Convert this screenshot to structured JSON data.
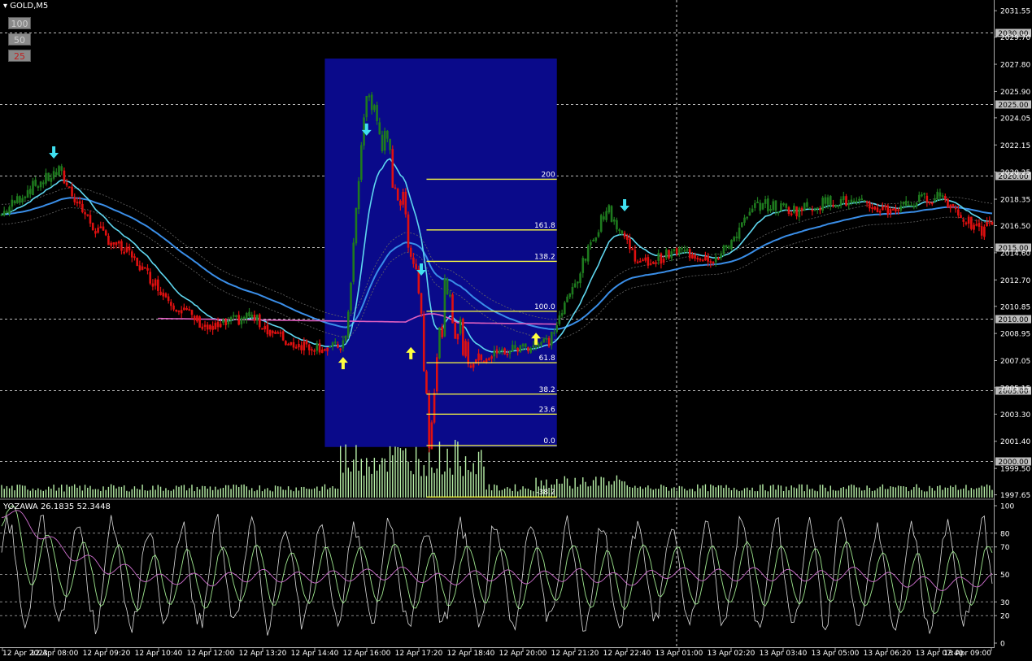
{
  "symbol_label": "GOLD,M5",
  "zoom_buttons": [
    "100",
    "50",
    "25"
  ],
  "indicator_label": "YOZAWA 26.1835 52.3448",
  "price_axis": [
    "2031.55",
    "2029.70",
    "2027.80",
    "2025.90",
    "2024.05",
    "2022.15",
    "2020.25",
    "2018.35",
    "2016.50",
    "2014.60",
    "2012.70",
    "2010.85",
    "2008.95",
    "2007.05",
    "2005.15",
    "2003.30",
    "2001.40",
    "1999.50",
    "1997.65"
  ],
  "level_lines": [
    "2030.00",
    "2025.00",
    "2020.00",
    "2015.00",
    "2010.00",
    "2005.00",
    "2000.00"
  ],
  "indicator_axis": [
    "100",
    "80",
    "70",
    "50",
    "30",
    "20",
    "0"
  ],
  "time_axis": [
    "12 Apr 2023",
    "12 Apr 08:00",
    "12 Apr 09:20",
    "12 Apr 10:40",
    "12 Apr 12:00",
    "12 Apr 13:20",
    "12 Apr 14:40",
    "12 Apr 16:00",
    "12 Apr 17:20",
    "12 Apr 18:40",
    "12 Apr 20:00",
    "12 Apr 21:20",
    "12 Apr 22:40",
    "13 Apr 01:00",
    "13 Apr 02:20",
    "13 Apr 03:40",
    "13 Apr 05:00",
    "13 Apr 06:20",
    "13 Apr 07:40",
    "13 Apr 09:00"
  ],
  "fib_levels": [
    {
      "label": "200",
      "price": 2019.75
    },
    {
      "label": "161.8",
      "price": 2016.2
    },
    {
      "label": "138.2",
      "price": 2014.0
    },
    {
      "label": "100.0",
      "price": 2010.5
    },
    {
      "label": "61.8",
      "price": 2006.9
    },
    {
      "label": "38.2",
      "price": 2004.7
    },
    {
      "label": "23.6",
      "price": 2003.3
    },
    {
      "label": "0.0",
      "price": 2001.1
    },
    {
      "label": "-38.2",
      "price": 1997.5
    }
  ],
  "colors": {
    "bull": "#1e7a1e",
    "bear": "#e01010",
    "fast_ma": "#5fd7f0",
    "slow_ma": "#3a8ee8",
    "pink_ma": "#e060c0",
    "fib": "#ffff40",
    "box": "#0a0a8a",
    "volume": "#b8f0a8",
    "arrow_up": "#ffff40",
    "arrow_down": "#40e0f0"
  },
  "chart_data": {
    "type": "candlestick",
    "symbol": "GOLD",
    "timeframe": "M5",
    "ylim": [
      1997.4,
      2032.3
    ],
    "indicator_ylim": [
      0,
      100
    ],
    "anchors": [
      {
        "bar": 0,
        "price": 2017.3
      },
      {
        "bar": 10,
        "price": 2019.0
      },
      {
        "bar": 22,
        "price": 2020.3
      },
      {
        "bar": 35,
        "price": 2016.4
      },
      {
        "bar": 50,
        "price": 2014.3
      },
      {
        "bar": 65,
        "price": 2011.2
      },
      {
        "bar": 80,
        "price": 2009.2
      },
      {
        "bar": 95,
        "price": 2010.2
      },
      {
        "bar": 110,
        "price": 2008.3
      },
      {
        "bar": 128,
        "price": 2007.9
      },
      {
        "bar": 132,
        "price": 2008.4
      },
      {
        "bar": 140,
        "price": 2026.0
      },
      {
        "bar": 148,
        "price": 2021.5
      },
      {
        "bar": 155,
        "price": 2017.0
      },
      {
        "bar": 160,
        "price": 2012.5
      },
      {
        "bar": 164,
        "price": 2002.2
      },
      {
        "bar": 170,
        "price": 2011.5
      },
      {
        "bar": 180,
        "price": 2007.0
      },
      {
        "bar": 195,
        "price": 2007.8
      },
      {
        "bar": 210,
        "price": 2008.4
      },
      {
        "bar": 220,
        "price": 2012.5
      },
      {
        "bar": 232,
        "price": 2017.8
      },
      {
        "bar": 245,
        "price": 2013.8
      },
      {
        "bar": 260,
        "price": 2014.7
      },
      {
        "bar": 275,
        "price": 2014.2
      },
      {
        "bar": 290,
        "price": 2018.0
      },
      {
        "bar": 305,
        "price": 2017.6
      },
      {
        "bar": 320,
        "price": 2018.3
      },
      {
        "bar": 340,
        "price": 2017.6
      },
      {
        "bar": 360,
        "price": 2018.7
      },
      {
        "bar": 375,
        "price": 2016.0
      },
      {
        "bar": 380,
        "price": 2016.7
      }
    ],
    "bars": 381,
    "up_arrows": [
      {
        "bar": 131,
        "price": 2007.3
      },
      {
        "bar": 157,
        "price": 2008.0
      },
      {
        "bar": 205,
        "price": 2009.0
      }
    ],
    "down_arrows": [
      {
        "bar": 20,
        "price": 2021.2
      },
      {
        "bar": 140,
        "price": 2022.8
      },
      {
        "bar": 161,
        "price": 2013.0
      },
      {
        "bar": 239,
        "price": 2017.5
      }
    ],
    "highlight_box": {
      "bar_start": 124,
      "bar_end": 213,
      "price_top": 2028.2,
      "price_bottom": 2001.0
    }
  }
}
